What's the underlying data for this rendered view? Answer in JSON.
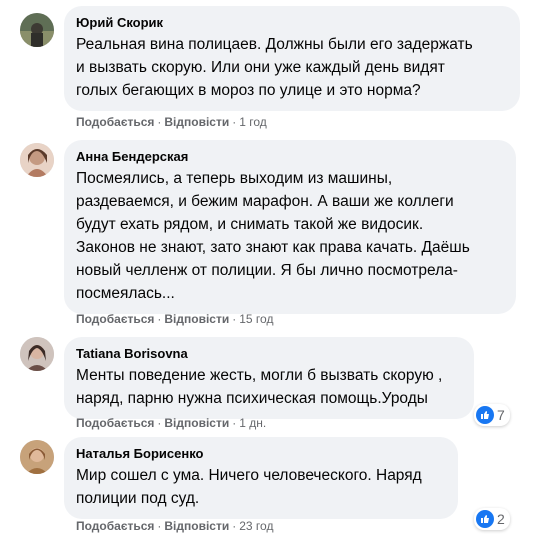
{
  "comments": [
    {
      "author": "Юрий Скорик",
      "lines": [
        "Реальная вина полицаев. Должны были его задержать",
        "и вызвать скорую. Или они уже каждый день видят",
        "голых бегающих в мороз по улице и это норма?"
      ],
      "like": "Подобається",
      "reply": "Відповісти",
      "time": "1 год",
      "reaction_count": ""
    },
    {
      "author": "Анна Бендерская",
      "lines": [
        "Посмеялись, а теперь выходим из машины,",
        "раздеваемся, и бежим марафон. А ваши же коллеги",
        "будут ехать рядом, и снимать такой же видосик.",
        "Законов не знают, зато знают как права качать. Даёшь",
        "новый челленж от полиции. Я бы лично посмотрела-",
        "посмеялась..."
      ],
      "like": "Подобається",
      "reply": "Відповісти",
      "time": "15 год",
      "reaction_count": ""
    },
    {
      "author": "Tatiana Borisovna",
      "lines": [
        "Менты поведение жесть, могли б вызвать скорую ,",
        "наряд, парню нужна психическая помощь.Уроды"
      ],
      "like": "Подобається",
      "reply": "Відповісти",
      "time": "1 дн.",
      "reaction_count": "7"
    },
    {
      "author": "Наталья Борисенко",
      "lines": [
        "Мир сошел с ума. Ничего человеческого. Наряд",
        "полиции под суд."
      ],
      "like": "Подобається",
      "reply": "Відповісти",
      "time": "23 год",
      "reaction_count": "2"
    }
  ],
  "colors": {
    "bubble": "#f0f2f5",
    "meta": "#65676b",
    "like_blue": "#1877f2"
  }
}
